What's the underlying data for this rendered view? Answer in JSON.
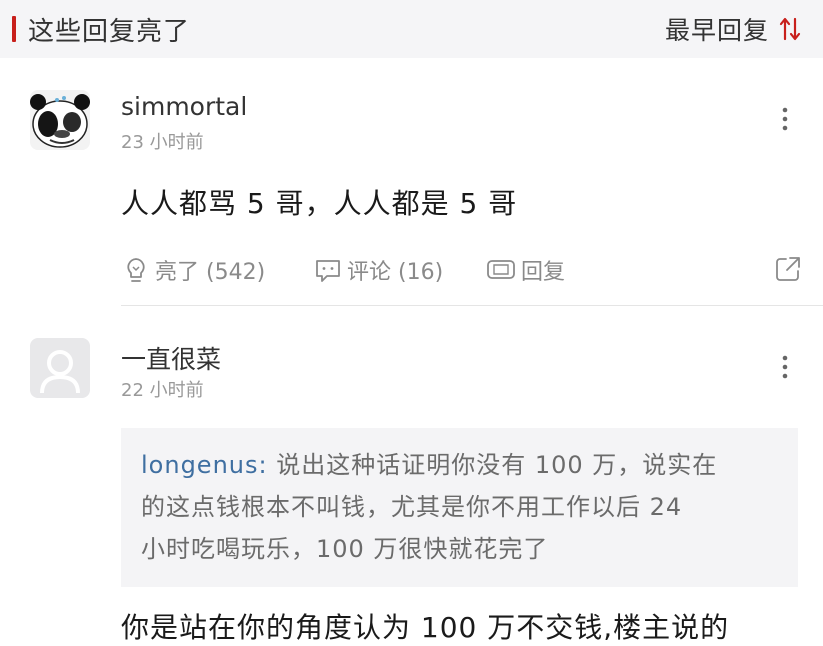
{
  "header": {
    "title": "这些回复亮了",
    "sort_label": "最早回复",
    "accent_color": "#c8201c"
  },
  "comments": [
    {
      "username": "simmortal",
      "time": "23 小时前",
      "content": "人人都骂 5 哥，人人都是 5 哥",
      "actions": {
        "like_label": "亮了 (542)",
        "comment_label": "评论 (16)",
        "reply_label": "回复"
      }
    },
    {
      "username": "一直很菜",
      "time": "22 小时前",
      "quote": {
        "user": "longenus:",
        "line1": " 说出这种话证明你没有 100 万，说实在",
        "line2": "的这点钱根本不叫钱，尤其是你不用工作以后 24",
        "line3": "小时吃喝玩乐，100 万很快就花完了"
      },
      "content": "你是站在你的角度认为 100 万不交钱,楼主说的"
    }
  ],
  "icons": {
    "avatar1": "panda-meme-avatar",
    "avatar2": "default-user-avatar",
    "like": "lightbulb-icon",
    "comment": "chat-bubble-icon",
    "reply": "reply-bubble-icon",
    "share": "share-icon",
    "more": "more-vertical-icon",
    "sort": "sort-arrows-icon"
  }
}
